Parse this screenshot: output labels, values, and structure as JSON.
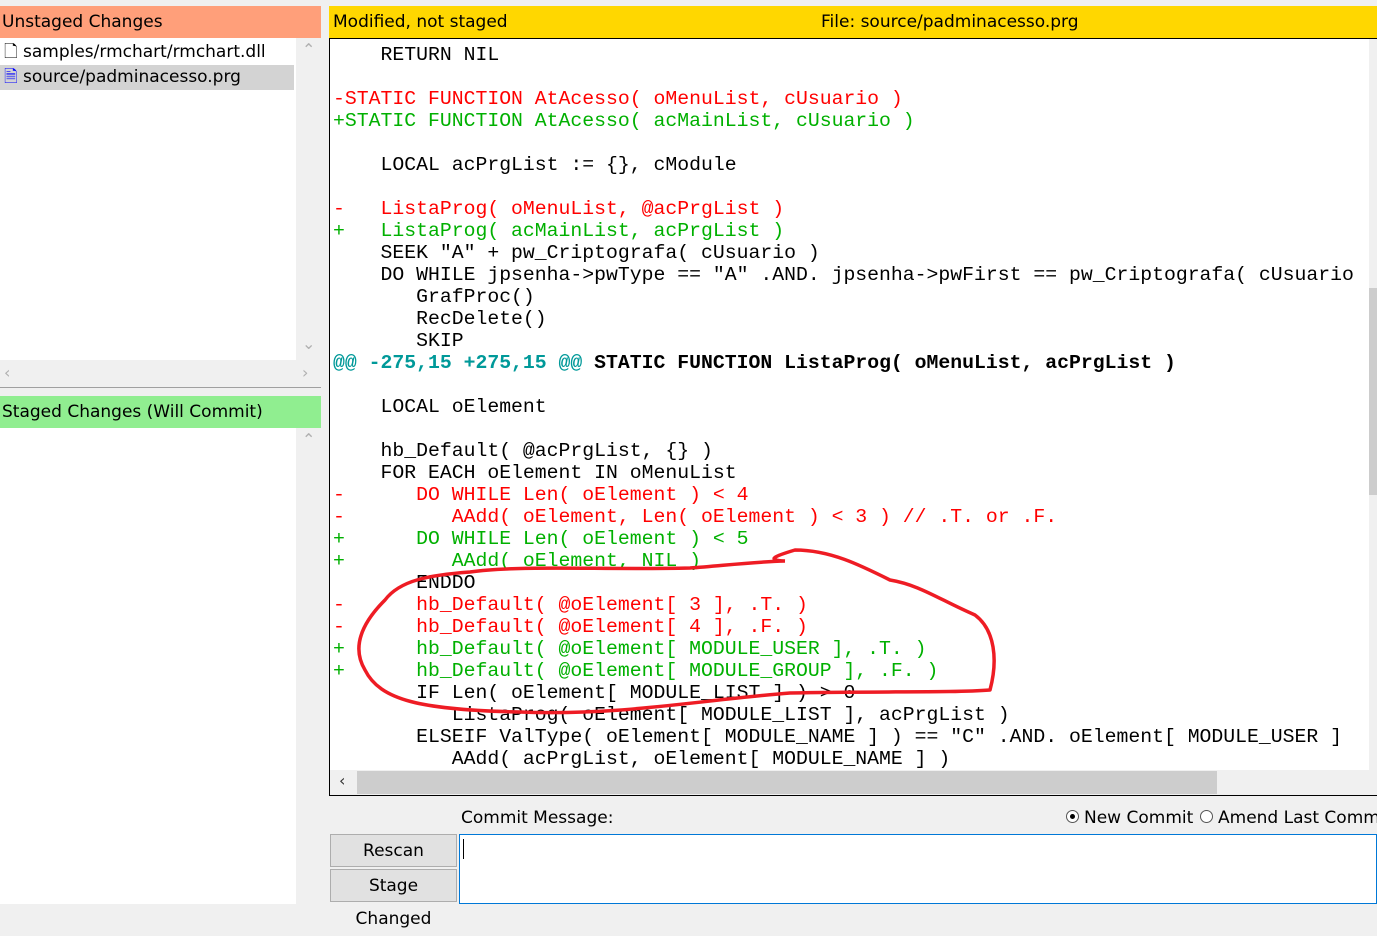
{
  "unstaged": {
    "title": "Unstaged Changes",
    "files": [
      {
        "name": "samples/rmchart/rmchart.dll",
        "icon": "file-icon",
        "selected": false
      },
      {
        "name": "source/padminacesso.prg",
        "icon": "text-file-icon",
        "selected": true
      }
    ]
  },
  "staged": {
    "title": "Staged Changes (Will Commit)"
  },
  "diff": {
    "status": "Modified, not staged",
    "file_label": "File:  source/padminacesso.prg",
    "lines": [
      {
        "t": "ctx",
        "s": "    RETURN NIL"
      },
      {
        "t": "ctx",
        "s": ""
      },
      {
        "t": "del",
        "s": "-STATIC FUNCTION AtAcesso( oMenuList, cUsuario )"
      },
      {
        "t": "add",
        "s": "+STATIC FUNCTION AtAcesso( acMainList, cUsuario )"
      },
      {
        "t": "ctx",
        "s": ""
      },
      {
        "t": "ctx",
        "s": "    LOCAL acPrgList := {}, cModule"
      },
      {
        "t": "ctx",
        "s": ""
      },
      {
        "t": "del",
        "s": "-   ListaProg( oMenuList, @acPrgList )"
      },
      {
        "t": "add",
        "s": "+   ListaProg( acMainList, acPrgList )"
      },
      {
        "t": "ctx",
        "s": "    SEEK \"A\" + pw_Criptografa( cUsuario )"
      },
      {
        "t": "ctx",
        "s": "    DO WHILE jpsenha->pwType == \"A\" .AND. jpsenha->pwFirst == pw_Criptografa( cUsuario"
      },
      {
        "t": "ctx",
        "s": "       GrafProc()"
      },
      {
        "t": "ctx",
        "s": "       RecDelete()"
      },
      {
        "t": "ctx",
        "s": "       SKIP"
      },
      {
        "t": "hunk",
        "m": "@@ -275,15 +275,15 @@",
        "s": " STATIC FUNCTION ListaProg( oMenuList, acPrgList )"
      },
      {
        "t": "ctx",
        "s": ""
      },
      {
        "t": "ctx",
        "s": "    LOCAL oElement"
      },
      {
        "t": "ctx",
        "s": ""
      },
      {
        "t": "ctx",
        "s": "    hb_Default( @acPrgList, {} )"
      },
      {
        "t": "ctx",
        "s": "    FOR EACH oElement IN oMenuList"
      },
      {
        "t": "del",
        "s": "-      DO WHILE Len( oElement ) < 4"
      },
      {
        "t": "del",
        "s": "-         AAdd( oElement, Len( oElement ) < 3 ) // .T. or .F."
      },
      {
        "t": "add",
        "s": "+      DO WHILE Len( oElement ) < 5"
      },
      {
        "t": "add",
        "s": "+         AAdd( oElement, NIL )"
      },
      {
        "t": "ctx",
        "s": "       ENDDO"
      },
      {
        "t": "del",
        "s": "-      hb_Default( @oElement[ 3 ], .T. )"
      },
      {
        "t": "del",
        "s": "-      hb_Default( @oElement[ 4 ], .F. )"
      },
      {
        "t": "add",
        "s": "+      hb_Default( @oElement[ MODULE_USER ], .T. )"
      },
      {
        "t": "add",
        "s": "+      hb_Default( @oElement[ MODULE_GROUP ], .F. )"
      },
      {
        "t": "ctx",
        "s": "       IF Len( oElement[ MODULE_LIST ] ) > 0"
      },
      {
        "t": "ctx",
        "s": "          ListaProg( oElement[ MODULE_LIST ], acPrgList )"
      },
      {
        "t": "ctx",
        "s": "       ELSEIF ValType( oElement[ MODULE_NAME ] ) == \"C\" .AND. oElement[ MODULE_USER ]"
      },
      {
        "t": "ctx",
        "s": "          AAdd( acPrgList, oElement[ MODULE_NAME ] )"
      }
    ]
  },
  "commit": {
    "label": "Commit Message:",
    "new_commit": "New Commit",
    "amend": "Amend Last Commit",
    "mode": "new",
    "message": ""
  },
  "buttons": {
    "rescan": "Rescan",
    "stage_changed": "Stage Changed"
  },
  "colors": {
    "unstaged": "#ff9f7a",
    "staged": "#90ee90",
    "diff_header": "#ffd700",
    "deleted": "#ff0000",
    "added": "#00b000",
    "hunk": "#009999",
    "annotation": "#ee1c24"
  }
}
